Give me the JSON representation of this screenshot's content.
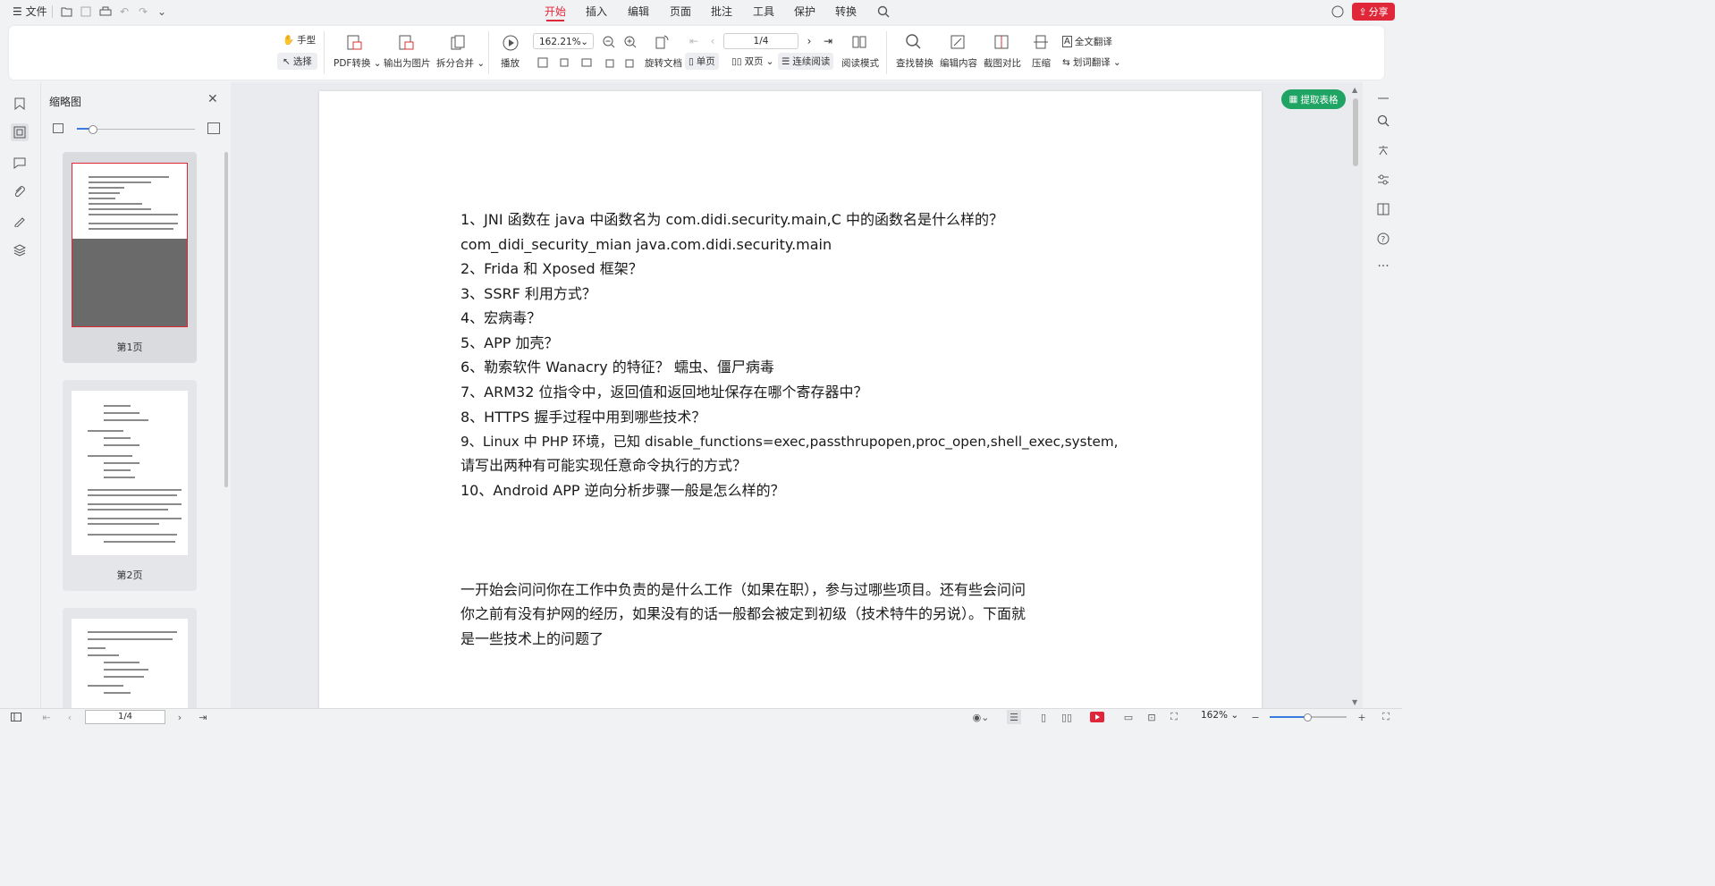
{
  "menubar": {
    "menu_label": "文件",
    "tabs": [
      "开始",
      "插入",
      "编辑",
      "页面",
      "批注",
      "工具",
      "保护",
      "转换"
    ],
    "active_tab": "开始",
    "share_label": "分享"
  },
  "toolbar": {
    "hand_label": "手型",
    "select_label": "选择",
    "pdf_convert": "PDF转换",
    "export_image": "输出为图片",
    "split_merge": "拆分合并",
    "play": "播放",
    "zoom_value": "162.21%",
    "rotate_doc": "旋转文档",
    "page_value": "1/4",
    "single_page": "单页",
    "double_page": "双页",
    "continuous": "连续阅读",
    "read_mode": "阅读模式",
    "find_replace": "查找替换",
    "edit_content": "编辑内容",
    "screenshot_compare": "截图对比",
    "compress": "压缩",
    "full_translate": "全文翻译",
    "word_translate": "划词翻译"
  },
  "thumbpanel": {
    "title": "缩略图",
    "pages": [
      {
        "label": "第1页"
      },
      {
        "label": "第2页"
      },
      {
        "label": ""
      }
    ]
  },
  "document": {
    "lines": [
      "1、JNI 函数在 java 中函数名为 com.didi.security.main,C 中的函数名是什么样的？",
      "com_didi_security_mian            java.com.didi.security.main",
      "2、Frida 和 Xposed 框架？",
      "3、SSRF 利用方式？",
      "4、宏病毒？",
      "5、APP 加壳？",
      "6、勒索软件 Wanacry 的特征？     蠕虫、僵尸病毒",
      "7、ARM32 位指令中，返回值和返回地址保存在哪个寄存器中？",
      "8、HTTPS 握手过程中用到哪些技术？",
      "9、Linux 中 PHP 环境，已知 disable_functions=exec,passthrupopen,proc_open,shell_exec,system,",
      "请写出两种有可能实现任意命令执行的方式？",
      "10、Android APP 逆向分析步骤一般是怎么样的？",
      "一开始会问问你在工作中负责的是什么工作（如果在职），参与过哪些项目。还有些会问问",
      "你之前有没有护网的经历，如果没有的话一般都会被定到初级（技术特牛的另说）。下面就",
      "是一些技术上的问题了"
    ],
    "extract_label": "提取表格"
  },
  "statusbar": {
    "page_value": "1/4",
    "zoom_value": "162%"
  },
  "colors": {
    "accent": "#e0273a",
    "green": "#1fa464"
  }
}
